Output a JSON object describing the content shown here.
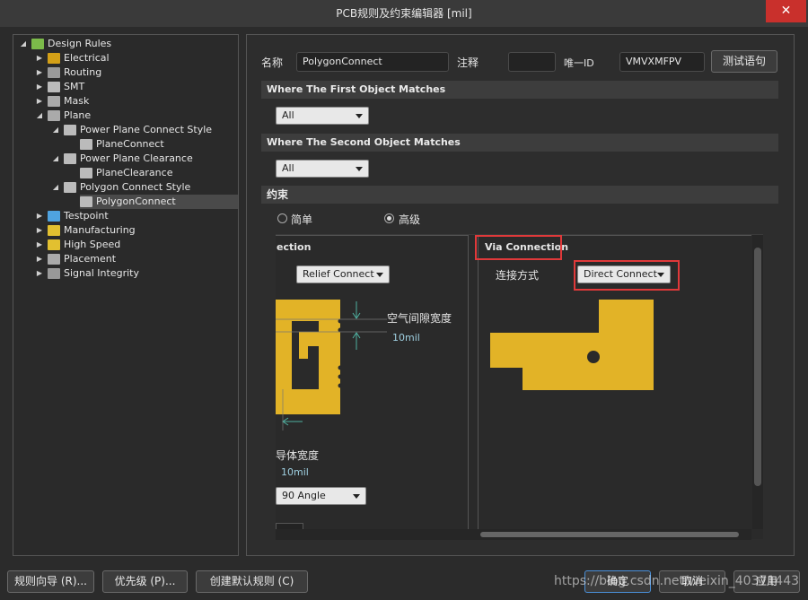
{
  "window": {
    "title": "PCB规则及约束编辑器 [mil]",
    "close_glyph": "✕"
  },
  "tree": [
    {
      "label": "Design Rules",
      "indent": 0,
      "expanded": true,
      "icon": "folder-icon"
    },
    {
      "label": "Electrical",
      "indent": 1,
      "icon": "electrical-icon"
    },
    {
      "label": "Routing",
      "indent": 1,
      "icon": "routing-icon"
    },
    {
      "label": "SMT",
      "indent": 1,
      "icon": "smt-icon"
    },
    {
      "label": "Mask",
      "indent": 1,
      "icon": "mask-icon"
    },
    {
      "label": "Plane",
      "indent": 1,
      "expanded": true,
      "icon": "plane-icon"
    },
    {
      "label": "Power Plane Connect Style",
      "indent": 2,
      "expanded": true,
      "icon": "rule-icon"
    },
    {
      "label": "PlaneConnect",
      "indent": 3,
      "icon": "rule-icon"
    },
    {
      "label": "Power Plane Clearance",
      "indent": 2,
      "expanded": true,
      "icon": "rule-icon"
    },
    {
      "label": "PlaneClearance",
      "indent": 3,
      "icon": "rule-icon"
    },
    {
      "label": "Polygon Connect Style",
      "indent": 2,
      "expanded": true,
      "icon": "rule-icon"
    },
    {
      "label": "PolygonConnect",
      "indent": 3,
      "icon": "rule-icon",
      "selected": true
    },
    {
      "label": "Testpoint",
      "indent": 1,
      "icon": "testpoint-icon"
    },
    {
      "label": "Manufacturing",
      "indent": 1,
      "icon": "manufacturing-icon"
    },
    {
      "label": "High Speed",
      "indent": 1,
      "icon": "high-speed-icon"
    },
    {
      "label": "Placement",
      "indent": 1,
      "icon": "placement-icon"
    },
    {
      "label": "Signal Integrity",
      "indent": 1,
      "icon": "signal-integrity-icon"
    }
  ],
  "header": {
    "name_label": "名称",
    "name_value": "PolygonConnect",
    "comment_label": "注释",
    "comment_value": "",
    "uid_label": "唯一ID",
    "uid_value": "VMVXMFPV",
    "test_button": "测试语句"
  },
  "first_match": {
    "title": "Where The First Object Matches",
    "value": "All"
  },
  "second_match": {
    "title": "Where The Second Object Matches",
    "value": "All"
  },
  "constraints": {
    "title": "约束",
    "simple_label": "简单",
    "advanced_label": "高级",
    "mode": "advanced"
  },
  "left_panel": {
    "title_fragment": "ection",
    "connect_value": "Relief Connect",
    "air_gap_label": "空气间隙宽度",
    "air_gap_value": "10mil",
    "conductor_label": "导体宽度",
    "conductor_value": "10mil",
    "angle_value": "90 Angle"
  },
  "via_panel": {
    "title": "Via Connection",
    "connect_label": "连接方式",
    "connect_value": "Direct Connect"
  },
  "footer": {
    "wizard": "规则向导 (R)...",
    "priority": "优先级 (P)...",
    "create_default": "创建默认规则 (C)",
    "ok": "确定",
    "cancel": "取消",
    "apply": "应用"
  },
  "watermark": "https://blog.csdn.net/weixin_40371443",
  "colors": {
    "copper": "#e2b327",
    "accent_red": "#e0393a",
    "close_red": "#c9302c"
  }
}
